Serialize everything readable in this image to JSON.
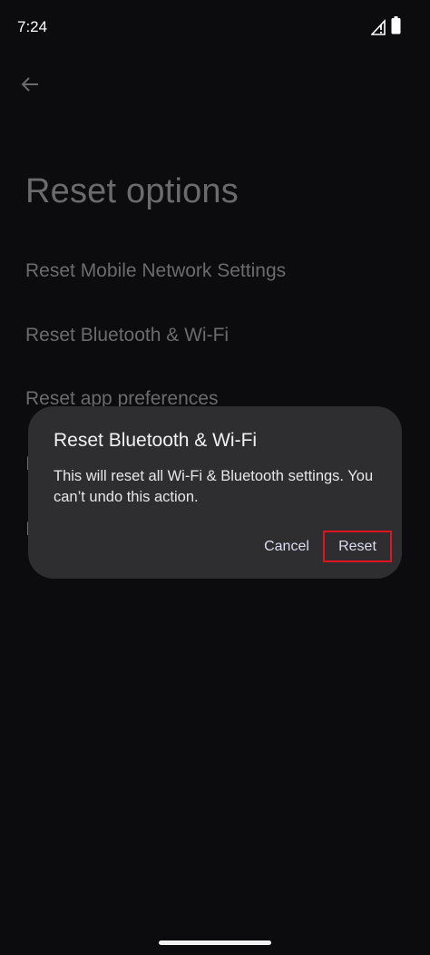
{
  "status_bar": {
    "time": "7:24",
    "signal_icon": "signal-no-service-icon",
    "battery_icon": "battery-icon"
  },
  "header": {
    "back_icon": "arrow-back-icon",
    "title": "Reset options"
  },
  "options": [
    {
      "label": "Reset Mobile Network Settings"
    },
    {
      "label": "Reset Bluetooth & Wi-Fi"
    },
    {
      "label": "Reset app preferences"
    }
  ],
  "dialog": {
    "title": "Reset Bluetooth & Wi-Fi",
    "message": "This will reset all Wi-Fi & Bluetooth settings. You can’t undo this action.",
    "cancel_label": "Cancel",
    "confirm_label": "Reset"
  },
  "colors": {
    "background": "#0c0c0e",
    "dialog_background": "#2e2e31",
    "highlight_border": "#e0141e",
    "button_text": "#dcdcf0"
  }
}
